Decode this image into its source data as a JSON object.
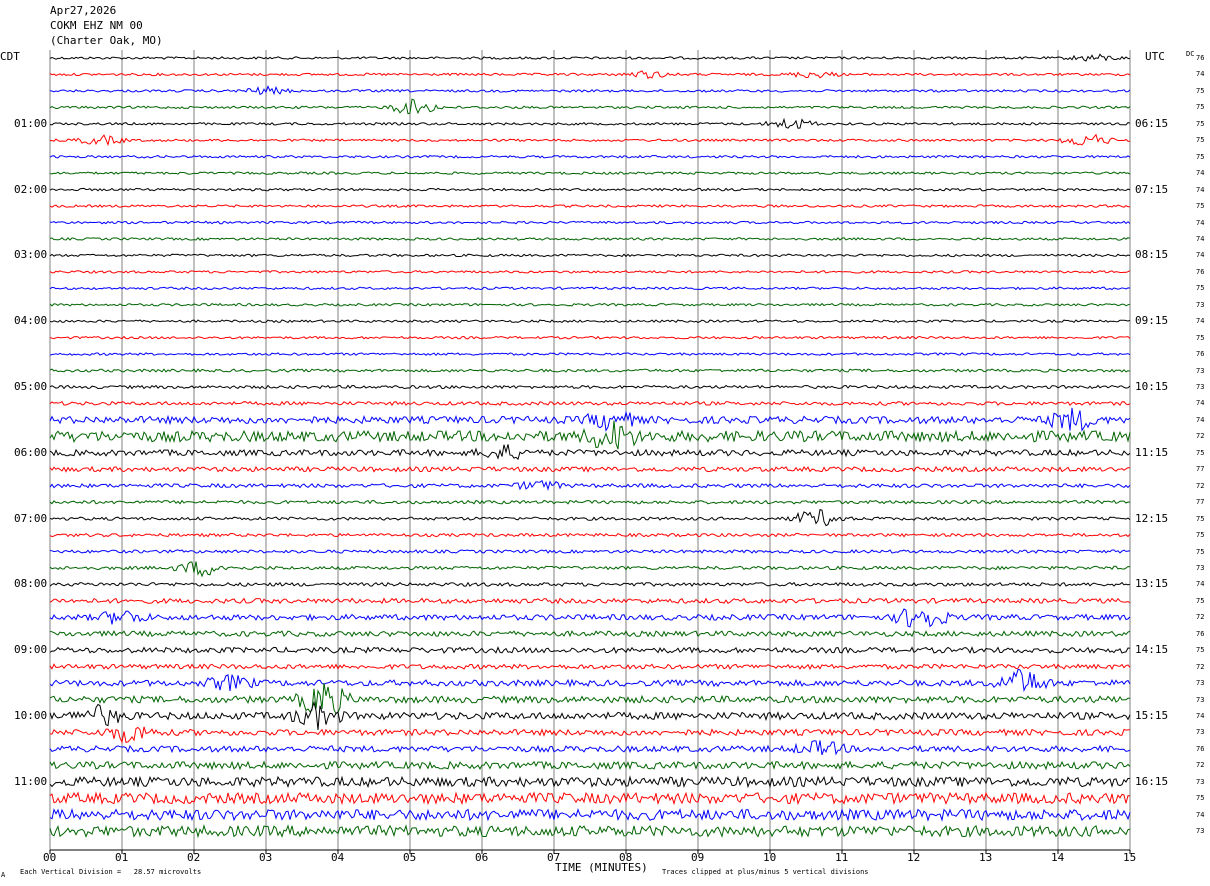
{
  "header": {
    "date": "Apr27,2026",
    "station": "COKM EHZ NM 00",
    "location": "(Charter Oak, MO)"
  },
  "labels": {
    "left_zone": "CDT",
    "right_zone": "UTC",
    "dc_label": "DC",
    "x_axis": "TIME (MINUTES)",
    "scale_note": "Each Vertical Division =   28.57 microvolts",
    "clip_note": "Traces clipped at plus/minus 5 vertical divisions",
    "corner_mark": "A"
  },
  "colors": {
    "trace_cycle": [
      "#000000",
      "#ff0000",
      "#0000ff",
      "#006400"
    ],
    "grid": "#808080",
    "background": "#ffffff"
  },
  "chart_data": {
    "type": "line",
    "title": "Apr27,2026 COKM EHZ NM 00 (Charter Oak, MO)",
    "xlabel": "TIME (MINUTES)",
    "xlim": [
      0,
      15
    ],
    "x_ticks": [
      "00",
      "01",
      "02",
      "03",
      "04",
      "05",
      "06",
      "07",
      "08",
      "09",
      "10",
      "11",
      "12",
      "13",
      "14",
      "15"
    ],
    "trace_count": 48,
    "trace_minutes": 15,
    "left_time_labels": [
      {
        "trace": 4,
        "label": "01:00"
      },
      {
        "trace": 8,
        "label": "02:00"
      },
      {
        "trace": 12,
        "label": "03:00"
      },
      {
        "trace": 16,
        "label": "04:00"
      },
      {
        "trace": 20,
        "label": "05:00"
      },
      {
        "trace": 24,
        "label": "06:00"
      },
      {
        "trace": 28,
        "label": "07:00"
      },
      {
        "trace": 32,
        "label": "08:00"
      },
      {
        "trace": 36,
        "label": "09:00"
      },
      {
        "trace": 40,
        "label": "10:00"
      },
      {
        "trace": 44,
        "label": "11:00"
      }
    ],
    "right_time_labels": [
      {
        "trace": 4,
        "label": "06:15"
      },
      {
        "trace": 8,
        "label": "07:15"
      },
      {
        "trace": 12,
        "label": "08:15"
      },
      {
        "trace": 16,
        "label": "09:15"
      },
      {
        "trace": 20,
        "label": "10:15"
      },
      {
        "trace": 24,
        "label": "11:15"
      },
      {
        "trace": 28,
        "label": "12:15"
      },
      {
        "trace": 32,
        "label": "13:15"
      },
      {
        "trace": 36,
        "label": "14:15"
      },
      {
        "trace": 40,
        "label": "15:15"
      },
      {
        "trace": 44,
        "label": "16:15"
      }
    ],
    "dc_offsets": [
      76,
      74,
      75,
      75,
      75,
      75,
      75,
      74,
      74,
      75,
      74,
      74,
      74,
      76,
      75,
      73,
      74,
      75,
      76,
      73,
      73,
      74,
      74,
      72,
      75,
      77,
      72,
      77,
      75,
      75,
      75,
      73,
      74,
      75,
      72,
      76,
      75,
      72,
      73,
      73,
      74,
      73,
      76,
      72,
      73,
      75,
      74,
      73
    ],
    "noise_level": [
      1,
      1,
      1,
      1,
      1,
      1,
      1,
      1,
      1,
      1,
      1,
      1,
      1,
      1,
      1,
      1,
      1,
      1,
      1,
      1.2,
      1.3,
      1.5,
      3,
      4.5,
      2.5,
      2,
      1.6,
      1.4,
      1.3,
      1.3,
      1.3,
      1.4,
      1.5,
      2,
      2.3,
      2.2,
      2.3,
      2,
      2.5,
      2.8,
      3,
      2.5,
      2.5,
      3,
      4,
      4.5,
      4.5,
      4.5
    ],
    "events": [
      {
        "trace": 0,
        "minute": 14.5,
        "amp": 1.5
      },
      {
        "trace": 1,
        "minute": 8.3,
        "amp": 1.5
      },
      {
        "trace": 1,
        "minute": 10.6,
        "amp": 1.4
      },
      {
        "trace": 2,
        "minute": 3.0,
        "amp": 1.6
      },
      {
        "trace": 3,
        "minute": 5.05,
        "amp": 3.5
      },
      {
        "trace": 4,
        "minute": 10.3,
        "amp": 2.5
      },
      {
        "trace": 5,
        "minute": 0.7,
        "amp": 2.0
      },
      {
        "trace": 5,
        "minute": 14.4,
        "amp": 3.0
      },
      {
        "trace": 22,
        "minute": 7.8,
        "amp": 4.0
      },
      {
        "trace": 22,
        "minute": 14.2,
        "amp": 4.5
      },
      {
        "trace": 23,
        "minute": 7.8,
        "amp": 6.0
      },
      {
        "trace": 24,
        "minute": 6.3,
        "amp": 3.0
      },
      {
        "trace": 26,
        "minute": 6.8,
        "amp": 2.0
      },
      {
        "trace": 28,
        "minute": 10.65,
        "amp": 4.0
      },
      {
        "trace": 31,
        "minute": 2.1,
        "amp": 3.5
      },
      {
        "trace": 34,
        "minute": 12.1,
        "amp": 6.0
      },
      {
        "trace": 34,
        "minute": 1.0,
        "amp": 3.0
      },
      {
        "trace": 38,
        "minute": 13.5,
        "amp": 6.0
      },
      {
        "trace": 38,
        "minute": 2.5,
        "amp": 3.0
      },
      {
        "trace": 39,
        "minute": 3.8,
        "amp": 8.0
      },
      {
        "trace": 40,
        "minute": 3.7,
        "amp": 5.0
      },
      {
        "trace": 40,
        "minute": 0.7,
        "amp": 4.0
      },
      {
        "trace": 41,
        "minute": 1.1,
        "amp": 4.0
      },
      {
        "trace": 42,
        "minute": 10.7,
        "amp": 3.0
      }
    ]
  }
}
